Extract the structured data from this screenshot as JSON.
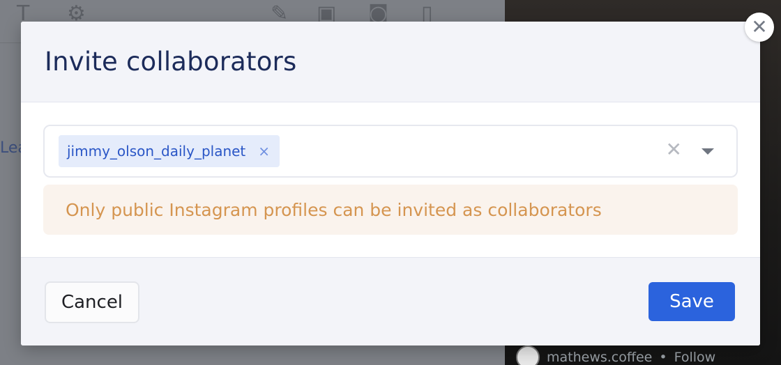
{
  "modal": {
    "title": "Invite collaborators",
    "selected_chip": "jimmy_olson_daily_planet",
    "chip_remove_glyph": "×",
    "clear_glyph": "✕",
    "close_glyph": "✕",
    "notice": "Only public Instagram profiles can be invited as collaborators",
    "cancel_label": "Cancel",
    "save_label": "Save"
  },
  "background": {
    "edge_text": "Lea",
    "footer_username": "mathews.coffee",
    "footer_separator": "•",
    "footer_follow": "Follow",
    "toolbar_icons": [
      "text-icon",
      "robot-icon",
      "pen-icon",
      "video-camera-icon",
      "camera-icon",
      "document-icon"
    ]
  },
  "colors": {
    "accent": "#2b63dd",
    "title": "#1c2b5a",
    "chip_bg": "#e5ecfb",
    "chip_text": "#2a56c6",
    "notice_bg": "#faf3ed",
    "notice_text": "#d59550"
  }
}
